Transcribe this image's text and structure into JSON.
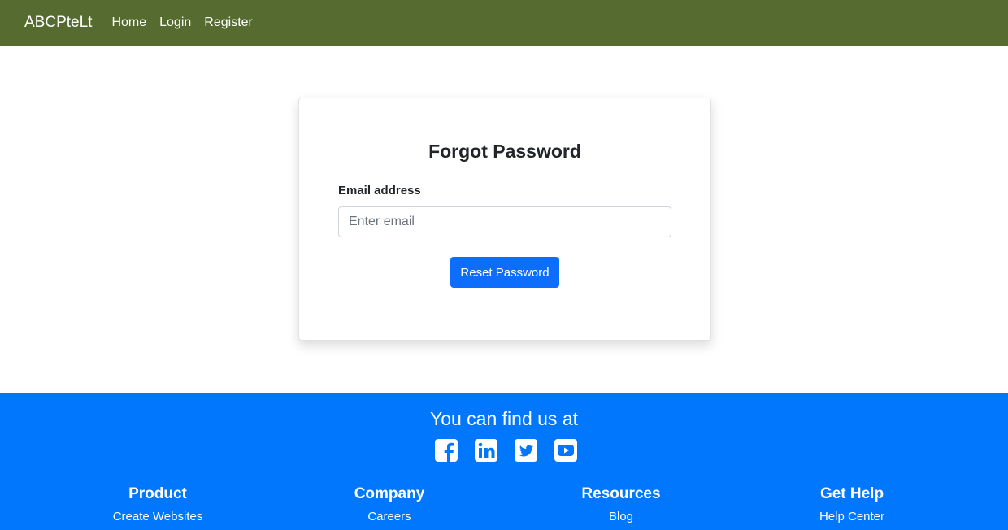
{
  "nav": {
    "brand": "ABCPteLt",
    "links": [
      "Home",
      "Login",
      "Register"
    ]
  },
  "form": {
    "title": "Forgot Password",
    "email_label": "Email address",
    "email_placeholder": "Enter email",
    "email_value": "",
    "submit_label": "Reset Password"
  },
  "footer": {
    "heading": "You can find us at",
    "social_icons": [
      "facebook-icon",
      "linkedin-icon",
      "twitter-icon",
      "youtube-icon"
    ],
    "columns": [
      {
        "title": "Product",
        "links": [
          "Create Websites"
        ]
      },
      {
        "title": "Company",
        "links": [
          "Careers"
        ]
      },
      {
        "title": "Resources",
        "links": [
          "Blog"
        ]
      },
      {
        "title": "Get Help",
        "links": [
          "Help Center"
        ]
      }
    ]
  },
  "colors": {
    "navbar_bg": "#566b30",
    "primary": "#0d6efd",
    "footer_bg": "#0077fc"
  }
}
